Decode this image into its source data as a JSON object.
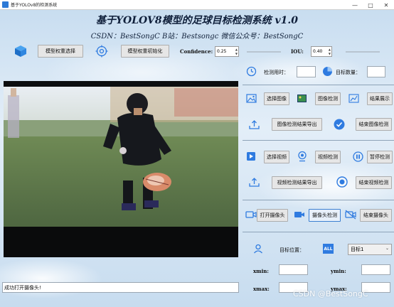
{
  "window": {
    "title": "基于YOLOv8的检测系统",
    "controls": [
      "—",
      "□",
      "✕"
    ]
  },
  "header": {
    "title": "基于YOLOV8模型的足球目标检测系统 v1.0",
    "subtitle": "CSDN：BestSongC   B站：Bestsongc   微信公众号：BestSongC"
  },
  "toolbar": {
    "select_weights_label": "模型权重选择",
    "init_weights_label": "模型权重初始化",
    "confidence_label": "Confidence:",
    "confidence_value": "0.25",
    "confidence_slider_fraction": 0.0,
    "iou_label": "IOU:",
    "iou_value": "0.40",
    "iou_slider_fraction": 0.0
  },
  "stats": {
    "time_label": "检测用时：",
    "time_value": "",
    "count_label": "目标数量：",
    "count_value": ""
  },
  "image_section": {
    "select_image_label": "选择图像",
    "detect_image_label": "图像检测",
    "show_result_label": "结果展示",
    "export_image_label": "图像检测结果导出",
    "end_image_label": "结束图像检测"
  },
  "video_section": {
    "select_video_label": "选择视频",
    "detect_video_label": "视频检测",
    "pause_label": "暂停检测",
    "export_video_label": "视频检测结果导出",
    "end_video_label": "结束视频检测"
  },
  "camera_section": {
    "open_camera_label": "打开摄像头",
    "camera_detect_label": "摄像头检测",
    "end_camera_label": "结束摄像头"
  },
  "target_section": {
    "position_label": "目标位置：",
    "all_badge": "ALL",
    "selected_target": "目标1",
    "xmin_label": "xmin:",
    "ymin_label": "ymin:",
    "xmax_label": "xmax:",
    "ymax_label": "ymax:",
    "xmin_value": "",
    "ymin_value": "",
    "xmax_value": "",
    "ymax_value": ""
  },
  "status_bar": {
    "message": "成功打开摄像头!"
  },
  "watermark": "CSDN @BestSongC",
  "colors": {
    "accent": "#2f7be0",
    "title": "#0f1f3a"
  }
}
